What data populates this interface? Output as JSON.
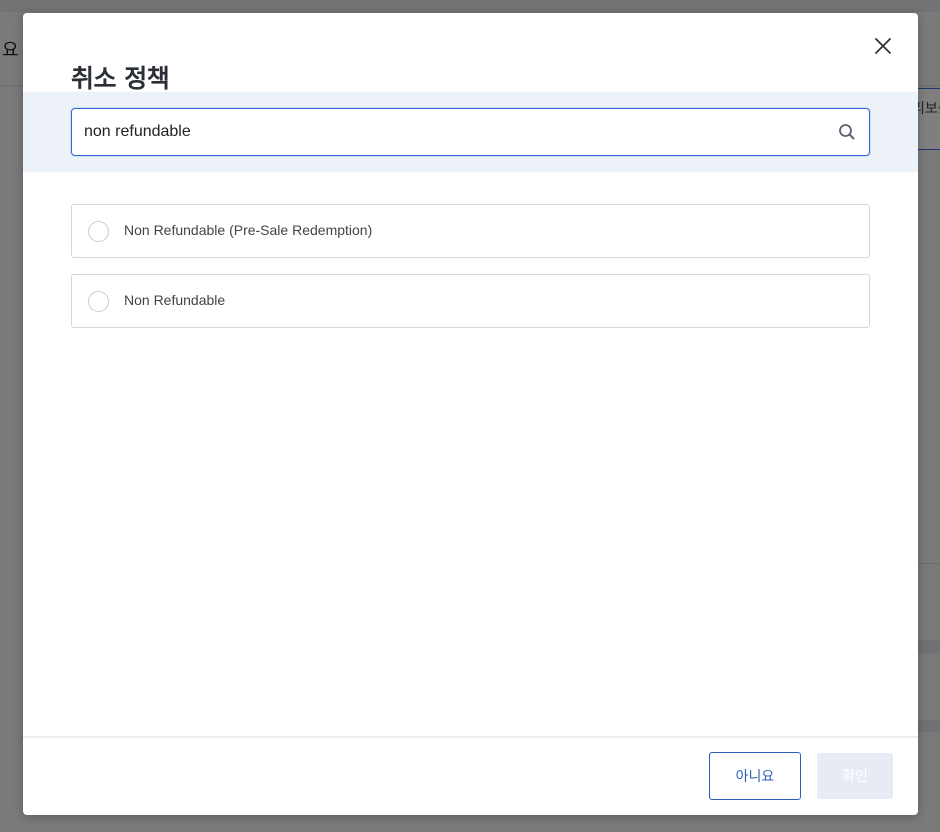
{
  "background": {
    "left_fragment": "요",
    "right_button_fragment": "리보를"
  },
  "modal": {
    "title": "취소 정책",
    "search": {
      "value": "non refundable",
      "placeholder": "",
      "icon": "search-icon"
    },
    "options": [
      {
        "label": "Non Refundable (Pre-Sale Redemption)",
        "selected": false
      },
      {
        "label": "Non Refundable",
        "selected": false
      }
    ],
    "footer": {
      "no_label": "아니요",
      "ok_label": "확인",
      "ok_disabled": true
    }
  },
  "colors": {
    "accent": "#2f68d3",
    "search_band": "#edf1f8",
    "disabled_button": "#e7ebf3"
  }
}
